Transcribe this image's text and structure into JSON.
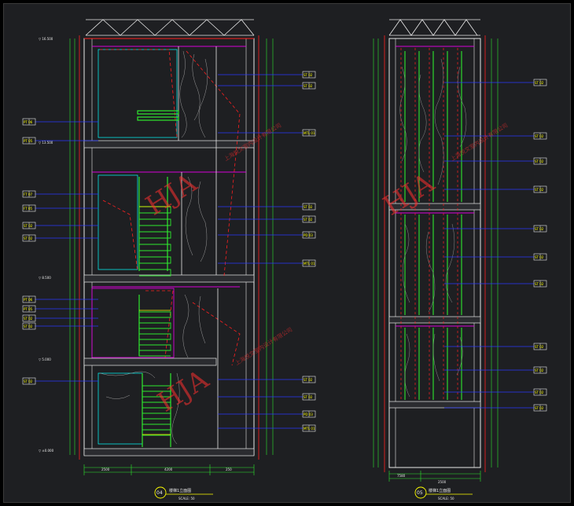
{
  "drawing_04": {
    "number": "04",
    "title": "楼梯1立面图",
    "scale": "SCALE: 50",
    "bottom_dims": [
      "2500",
      "4200",
      "250"
    ],
    "level_marks": [
      "▽ 16.500",
      "▽ 13.500",
      "▽ 8.500",
      "▽ 5.000",
      "▽ ±0.000"
    ],
    "material_tags_left": [
      "PT 06",
      "PT 05",
      "FT 07",
      "FT 05",
      "ST 02",
      "ST 02",
      "PT 06",
      "PT 05",
      "ST 02",
      "ST 02",
      "ST 02"
    ],
    "material_tags_right": [
      "ST 02",
      "ST 02",
      "MTL 01",
      "ST 02",
      "ST 02",
      "PD 03",
      "MTL 01",
      "ST 02",
      "ST 02",
      "PD 03",
      "MTL 01"
    ]
  },
  "drawing_05": {
    "number": "05",
    "title": "楼梯1立面图",
    "scale": "SCALE: 50",
    "bottom_dims": [
      "7580",
      "2500"
    ],
    "material_tags_right": [
      "ST 02",
      "ST 02",
      "ST 02",
      "ST 02",
      "ST 02",
      "ST 02",
      "ST 02",
      "ST 02",
      "ST 02",
      "ST 02",
      "ST 02"
    ]
  },
  "watermark": {
    "logo": "HJA",
    "company": "上海悦文室内设计有限公司"
  },
  "colors": {
    "background": "#1e1f22",
    "green": "#2ee82e",
    "cyan": "#00ffff",
    "yellow": "#ffff00",
    "blue": "#2a3aff",
    "magenta": "#d800d8",
    "red": "#ff2020",
    "white": "#e8e8e8"
  }
}
